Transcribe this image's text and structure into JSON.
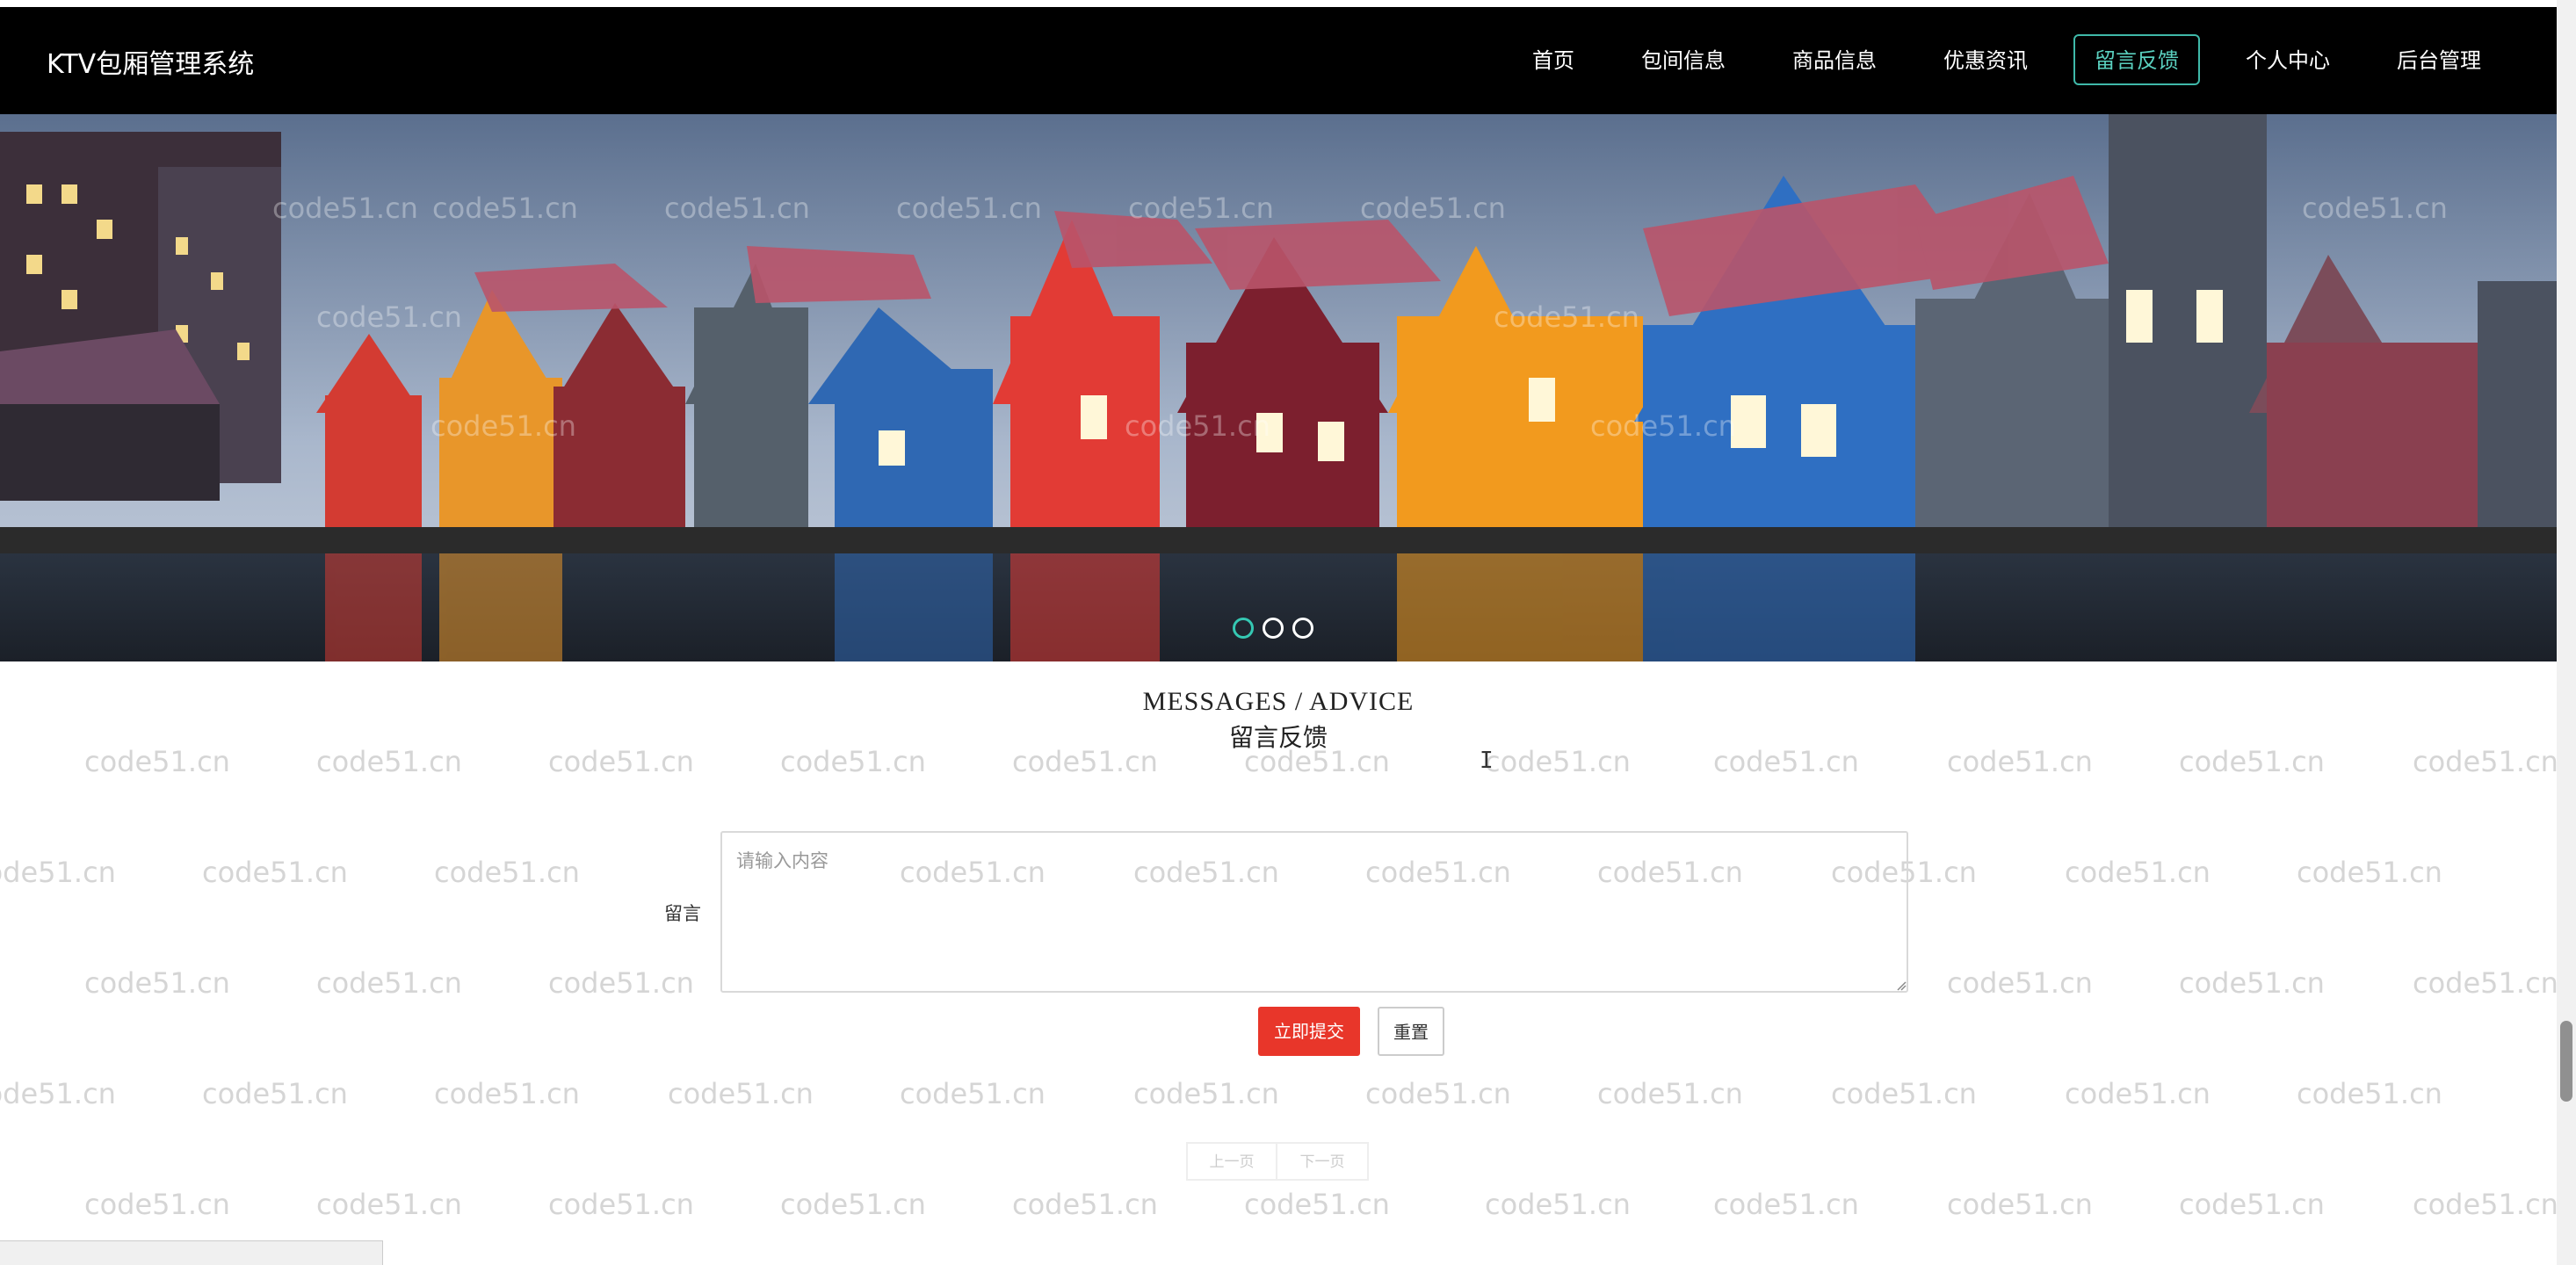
{
  "brand": "KTV包厢管理系统",
  "nav": {
    "items": [
      {
        "label": "首页"
      },
      {
        "label": "包间信息"
      },
      {
        "label": "商品信息"
      },
      {
        "label": "优惠资讯"
      },
      {
        "label": "留言反馈",
        "active": true
      },
      {
        "label": "个人中心"
      },
      {
        "label": "后台管理"
      }
    ],
    "active_color": "#3fb9a9"
  },
  "banner": {
    "slides_count": 3,
    "active_slide": 1,
    "image": "colorful-waterfront-houses"
  },
  "watermark": "code51.cn",
  "section": {
    "title_en": "MESSAGES / ADVICE",
    "title_cn": "留言反馈"
  },
  "form": {
    "label": "留言",
    "placeholder": "请输入内容",
    "value": "",
    "submit_label": "立即提交",
    "reset_label": "重置",
    "submit_color": "#e8362a"
  },
  "pager": {
    "prev_label": "上一页",
    "next_label": "下一页"
  }
}
